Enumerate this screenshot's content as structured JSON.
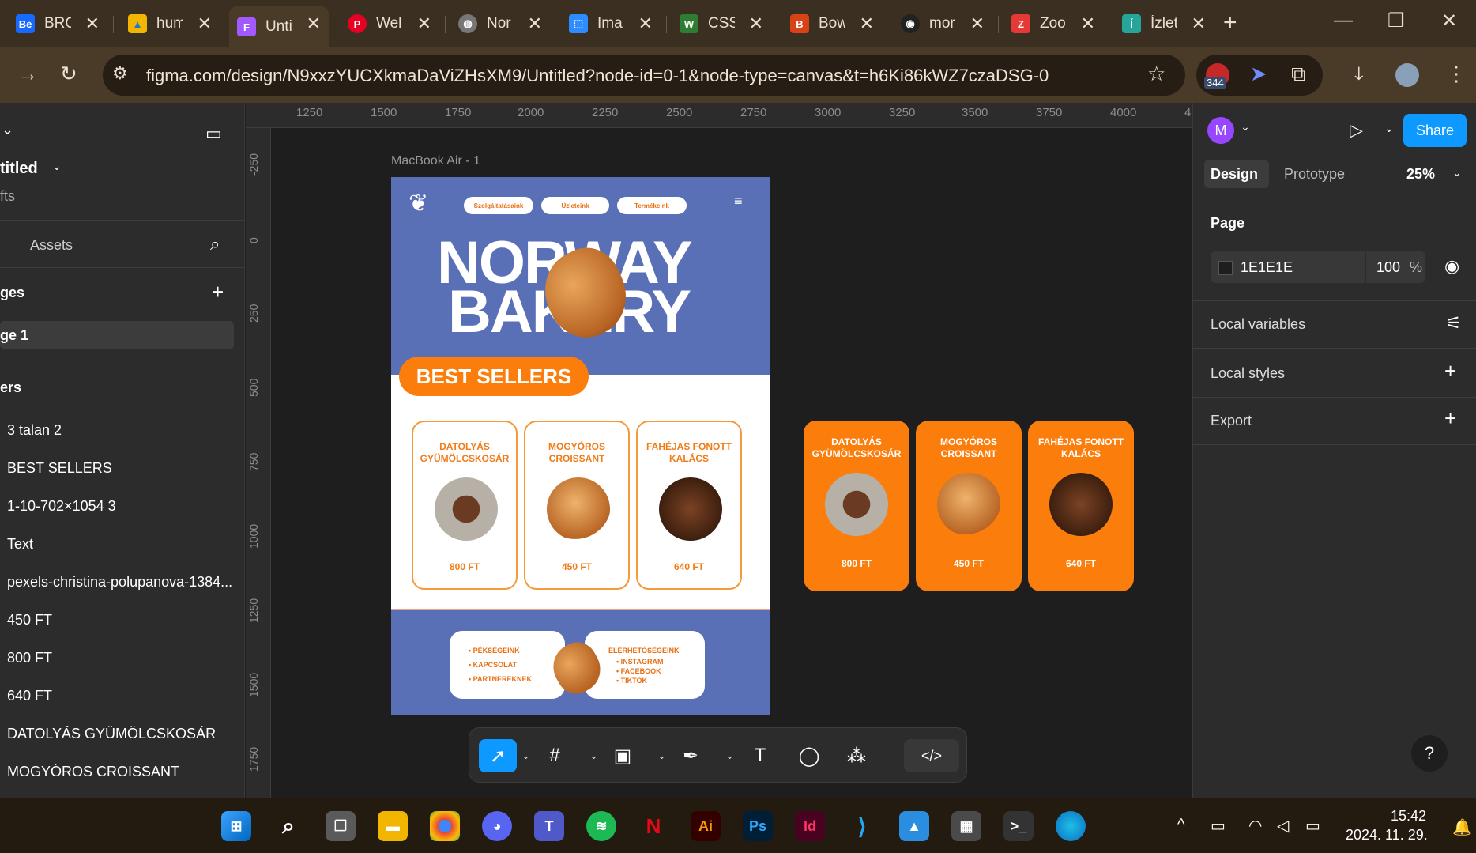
{
  "browser": {
    "tabs": [
      {
        "title": "BRO",
        "fav": "Bē",
        "color": "#1769ff"
      },
      {
        "title": "hum",
        "fav": "▲",
        "color": "#f2b600"
      },
      {
        "title": "Unti",
        "fav": "F",
        "color": "#a259ff"
      },
      {
        "title": "Wel",
        "fav": "P",
        "color": "#e60023"
      },
      {
        "title": "Nor",
        "fav": "◍",
        "color": "#777777"
      },
      {
        "title": "Ima",
        "fav": "⬚",
        "color": "#2d8cff"
      },
      {
        "title": "CSS",
        "fav": "W",
        "color": "#2e7d32"
      },
      {
        "title": "Bow",
        "fav": "B",
        "color": "#d84315"
      },
      {
        "title": "mor",
        "fav": "◉",
        "color": "#222222"
      },
      {
        "title": "Zoo",
        "fav": "Z",
        "color": "#e53935"
      },
      {
        "title": "Ízlet",
        "fav": "Í",
        "color": "#26a69a"
      }
    ],
    "url": "figma.com/design/N9xxzYUCXkmaDaViZHsXM9/Untitled?node-id=0-1&node-type=canvas&t=h6Ki86kWZ7czaDSG-0",
    "ext_badge": "344"
  },
  "left_panel": {
    "file_name": "titled",
    "file_sub": "fts",
    "assets_tab": "Assets",
    "pages_header": "ges",
    "page1": "ge 1",
    "layers_header": "ers",
    "layers": [
      "3 talan 2",
      "BEST SELLERS",
      "1-10-702×1054 3",
      "Text",
      "pexels-christina-polupanova-1384...",
      "450 FT",
      "800 FT",
      "640 FT",
      "DATOLYÁS GYÜMÖLCSKOSÁR",
      "MOGYÓROS CROISSANT"
    ]
  },
  "ruler": {
    "top": [
      "1250",
      "1500",
      "1750",
      "2000",
      "2250",
      "2500",
      "2750",
      "3000",
      "3250",
      "3500",
      "3750",
      "4000",
      "4"
    ],
    "left": [
      "-250",
      "0",
      "250",
      "500",
      "750",
      "1000",
      "1250",
      "1500",
      "1750"
    ]
  },
  "canvas": {
    "frame_label": "MacBook Air - 1",
    "nav": [
      "Szolgáltatásaink",
      "Üzleteink",
      "Termékeink"
    ],
    "hero_line1": "NORWAY",
    "hero_line2": "BAKERY",
    "best_sellers": "BEST SELLERS",
    "cards": [
      {
        "name": "DATOLYÁS GYÜMÖLCSKOSÁR",
        "price": "800 FT"
      },
      {
        "name": "MOGYÓROS CROISSANT",
        "price": "450 FT"
      },
      {
        "name": "FAHÉJAS FONOTT KALÁCS",
        "price": "640 FT"
      }
    ],
    "orange_cards": [
      {
        "name": "DATOLYÁS GYÜMÖLCSKOSÁR",
        "price": "800 FT"
      },
      {
        "name": "MOGYÓROS CROISSANT",
        "price": "450 FT"
      },
      {
        "name": "FAHÉJAS FONOTT KALÁCS",
        "price": "640 FT"
      }
    ],
    "footer_left": [
      "PÉKSÉGEINK",
      "KAPCSOLAT",
      "PARTNEREKNEK"
    ],
    "footer_right_title": "ELÉRHETŐSÉGEINK",
    "footer_right": [
      "INSTAGRAM",
      "FACEBOOK",
      "TIKTOK"
    ]
  },
  "right_panel": {
    "avatar": "M",
    "share": "Share",
    "tab_design": "Design",
    "tab_prototype": "Prototype",
    "zoom": "25%",
    "page_header": "Page",
    "bg_color": "1E1E1E",
    "opacity": "100",
    "opacity_unit": "%",
    "local_variables": "Local variables",
    "local_styles": "Local styles",
    "export": "Export",
    "help": "?"
  },
  "taskbar": {
    "time": "15:42",
    "date": "2024. 11. 29."
  },
  "colors": {
    "accent": "#fb7d0c",
    "frame_blue": "#5970b6",
    "figma_blue": "#0d99ff"
  }
}
